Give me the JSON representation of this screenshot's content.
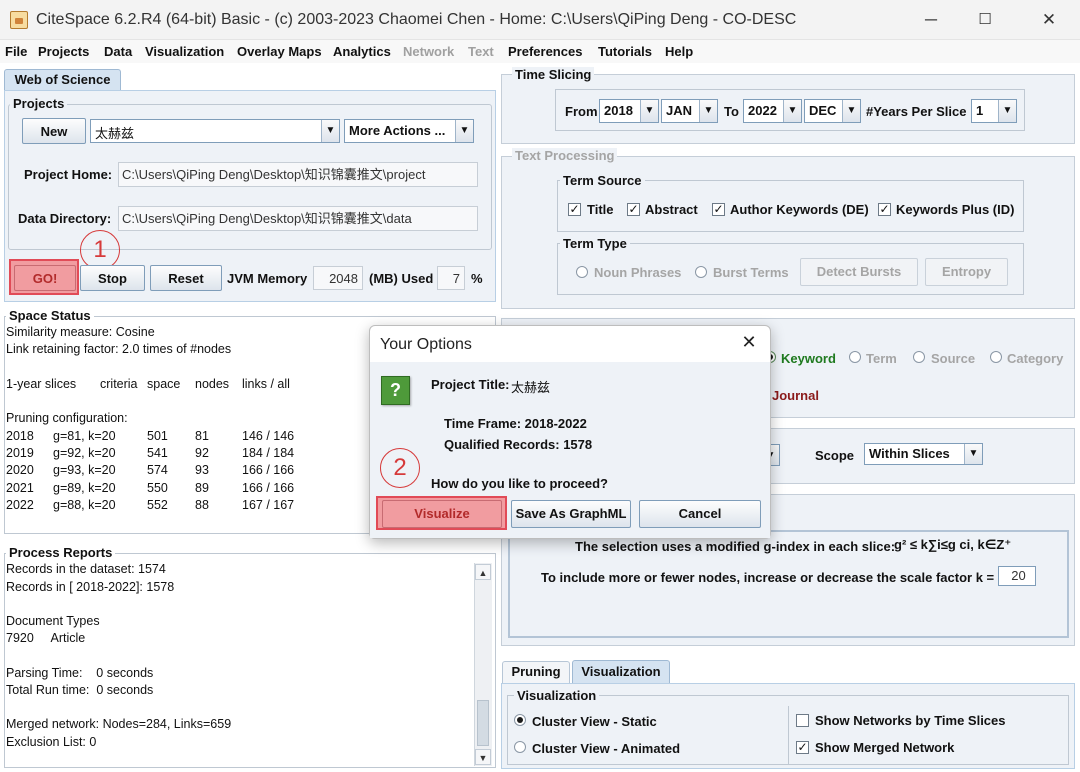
{
  "window": {
    "title": "CiteSpace 6.2.R4 (64-bit) Basic - (c) 2003-2023 Chaomei Chen - Home: C:\\Users\\QiPing Deng - CO-DESC"
  },
  "menu": [
    "File",
    "Projects",
    "Data",
    "Visualization",
    "Overlay Maps",
    "Analytics",
    "Network",
    "Text",
    "Preferences",
    "Tutorials",
    "Help"
  ],
  "left": {
    "tab": "Web of Science",
    "projects": {
      "group_label": "Projects",
      "new_btn": "New",
      "project_name": "太赫兹",
      "more_actions": "More Actions ...",
      "home_label": "Project Home:",
      "home_value": "C:\\Users\\QiPing Deng\\Desktop\\知识锦囊推文\\project",
      "data_label": "Data Directory:",
      "data_value": "C:\\Users\\QiPing Deng\\Desktop\\知识锦囊推文\\data"
    },
    "controls": {
      "go": "GO!",
      "stop": "Stop",
      "reset": "Reset",
      "jvm_label": "JVM Memory",
      "jvm_value": "2048",
      "mb_label": "(MB) Used",
      "used_value": "7",
      "percent": "%"
    },
    "space_status": {
      "label": "Space Status",
      "lines": [
        "Similarity measure: Cosine",
        "Link retaining factor: 2.0 times of #nodes",
        "",
        "1-year slices",
        "",
        "Pruning configuration:"
      ],
      "headers": [
        "criteria",
        "space",
        "nodes",
        "links / all"
      ],
      "rows": [
        {
          "year": "2018",
          "criteria": "g=81, k=20",
          "space": "501",
          "nodes": "81",
          "links": "146 / 146"
        },
        {
          "year": "2019",
          "criteria": "g=92, k=20",
          "space": "541",
          "nodes": "92",
          "links": "184 / 184"
        },
        {
          "year": "2020",
          "criteria": "g=93, k=20",
          "space": "574",
          "nodes": "93",
          "links": "166 / 166"
        },
        {
          "year": "2021",
          "criteria": "g=89, k=20",
          "space": "550",
          "nodes": "89",
          "links": "166 / 166"
        },
        {
          "year": "2022",
          "criteria": "g=88, k=20",
          "space": "552",
          "nodes": "88",
          "links": "167 / 167"
        }
      ]
    },
    "process_reports": {
      "label": "Process Reports",
      "lines": [
        "Records in the dataset: 1574",
        "Records in [ 2018-2022]: 1578",
        "",
        "Document Types",
        "7920     Article",
        "",
        "Parsing Time:    0 seconds",
        "Total Run time:  0 seconds",
        "",
        "Merged network: Nodes=284, Links=659",
        "Exclusion List: 0"
      ]
    }
  },
  "right": {
    "time_slicing": {
      "label": "Time Slicing",
      "from": "From",
      "from_year": "2018",
      "from_month": "JAN",
      "to": "To",
      "to_year": "2022",
      "to_month": "DEC",
      "years_per_slice_label": "#Years Per Slice",
      "years_per_slice": "1"
    },
    "text_processing": {
      "label": "Text Processing",
      "term_source": {
        "label": "Term Source",
        "items": [
          "Title",
          "Abstract",
          "Author Keywords (DE)",
          "Keywords Plus (ID)"
        ]
      },
      "term_type": {
        "label": "Term Type",
        "noun_phrases": "Noun Phrases",
        "burst_terms": "Burst Terms",
        "detect_bursts": "Detect Bursts",
        "entropy": "Entropy"
      }
    },
    "node_types": {
      "keyword": "Keyword",
      "term": "Term",
      "source": "Source",
      "category": "Category",
      "journal": "Journal"
    },
    "scope": {
      "label": "Scope",
      "value": "Within Slices"
    },
    "selection": {
      "formula_text": "The selection uses a modified g-index in each slice:",
      "formula": "g² ≤ k∑i≤g ci, k∈Z⁺",
      "scale_text": "To include more or fewer nodes, increase or decrease the scale factor k =",
      "k_value": "20"
    },
    "tabs": {
      "pruning": "Pruning",
      "visualization": "Visualization"
    },
    "visualization": {
      "label": "Visualization",
      "cluster_static": "Cluster View - Static",
      "cluster_animated": "Cluster View - Animated",
      "show_time_slices": "Show Networks by Time Slices",
      "show_merged": "Show Merged Network"
    }
  },
  "dialog": {
    "title": "Your Options",
    "icon": "?",
    "project_title_label": "Project Title:",
    "project_title_value": "太赫兹",
    "time_frame": "Time Frame: 2018-2022",
    "qualified_records": "Qualified Records: 1578",
    "question": "How do you like to proceed?",
    "visualize": "Visualize",
    "save_graphml": "Save As GraphML",
    "cancel": "Cancel"
  },
  "annotations": {
    "step1": "1",
    "step2": "2"
  },
  "colors": {
    "highlight": "#f19ca0",
    "annotation": "#d63a3a",
    "keyword_green": "#1f7a1f",
    "journal_maroon": "#8b1a1a"
  }
}
